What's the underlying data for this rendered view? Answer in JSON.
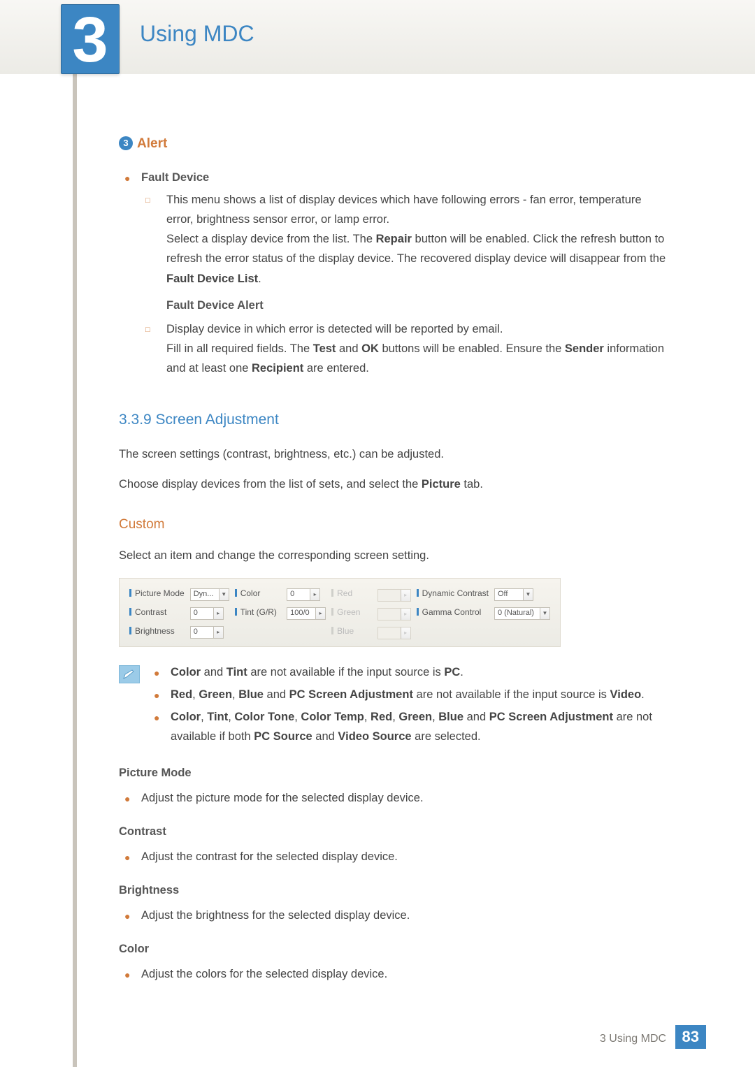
{
  "chapter": {
    "number": "3",
    "title": "Using MDC"
  },
  "alert": {
    "badge": "3",
    "title": "Alert",
    "fault_device_label": "Fault Device",
    "fault_device_p1": "This menu shows a list of display devices which have following errors - fan error, temperature error, brightness sensor error, or lamp error.",
    "fault_device_p2a": "Select a display device from the list. The ",
    "repair": "Repair",
    "fault_device_p2b": " button will be enabled. Click the refresh button to refresh the error status of the display device. The recovered display device will disappear from the ",
    "fault_device_list": "Fault Device List",
    "period": ".",
    "fault_alert_label": "Fault Device Alert",
    "fault_alert_p1": "Display device in which error is detected will be reported by email.",
    "fault_alert_p2a": "Fill in all required fields. The ",
    "test": "Test",
    "and": " and ",
    "ok": "OK",
    "fault_alert_p2b": " buttons will be enabled. Ensure the ",
    "sender": "Sender",
    "fault_alert_p2c": " information and at least one ",
    "recipient": "Recipient",
    "fault_alert_p2d": " are entered."
  },
  "screen_adj": {
    "heading": "3.3.9   Screen Adjustment",
    "p1": "The screen settings (contrast, brightness, etc.) can be adjusted.",
    "p2a": "Choose display devices from the list of sets, and select the ",
    "picture_tab": "Picture",
    "p2b": " tab."
  },
  "custom": {
    "heading": "Custom",
    "intro": "Select an item and change the corresponding screen setting."
  },
  "panel": {
    "picture_mode": "Picture Mode",
    "picture_mode_val": "Dyn...",
    "color": "Color",
    "color_val": "0",
    "red": "Red",
    "dynamic_contrast": "Dynamic Contrast",
    "dynamic_contrast_val": "Off",
    "contrast": "Contrast",
    "contrast_val": "0",
    "tint": "Tint (G/R)",
    "tint_val": "100/0",
    "green": "Green",
    "gamma": "Gamma Control",
    "gamma_val": "0 (Natural)",
    "brightness": "Brightness",
    "brightness_val": "0",
    "blue": "Blue"
  },
  "notes": {
    "n1": {
      "b1": "Color",
      "and": " and ",
      "b2": "Tint",
      "rest": " are not available if the input source is ",
      "b3": "PC",
      "end": "."
    },
    "n2": {
      "b1": "Red",
      "c": ", ",
      "b2": "Green",
      "b3": "Blue",
      "and": " and ",
      "b4": "PC Screen Adjustment",
      "rest": " are not available if the input source is ",
      "b5": "Video",
      "end": "."
    },
    "n3": {
      "b1": "Color",
      "c": ", ",
      "b2": "Tint",
      "b3": "Color Tone",
      "b4": "Color Temp",
      "b5": "Red",
      "b6": "Green",
      "b7": "Blue",
      "and": " and ",
      "b8": "PC Screen Adjustment",
      "rest1": " are not available if both ",
      "b9": "PC Source",
      "and2": " and ",
      "b10": "Video Source",
      "rest2": " are selected."
    }
  },
  "defs": {
    "picture_mode": {
      "h": "Picture Mode",
      "t": "Adjust the picture mode for the selected display device."
    },
    "contrast": {
      "h": "Contrast",
      "t": "Adjust the contrast for the selected display device."
    },
    "brightness": {
      "h": "Brightness",
      "t": "Adjust the brightness for the selected display device."
    },
    "color": {
      "h": "Color",
      "t": "Adjust the colors for the selected display device."
    }
  },
  "footer": {
    "label": "3 Using MDC",
    "page": "83"
  }
}
